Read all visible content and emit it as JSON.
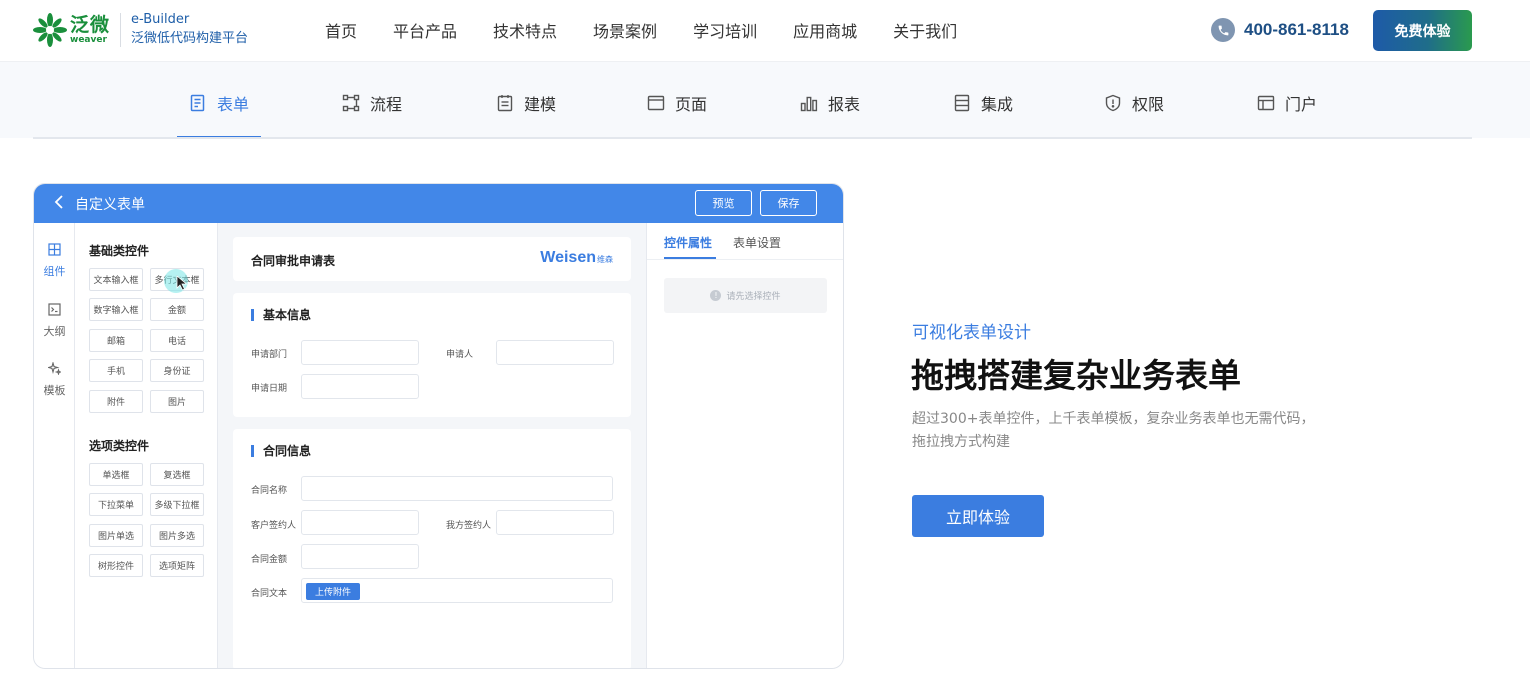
{
  "colors": {
    "brand_green": "#1a8f3c",
    "accent_blue": "#3b7de0",
    "header_blue": "#4287e8",
    "phone_navy": "#1e4f84"
  },
  "header": {
    "logo_cn": "泛微",
    "logo_en": "weaver",
    "product_name": "e-Builder",
    "product_sub": "泛微低代码构建平台",
    "nav": [
      "首页",
      "平台产品",
      "技术特点",
      "场景案例",
      "学习培训",
      "应用商城",
      "关于我们"
    ],
    "phone_icon": "phone-icon",
    "phone": "400-861-8118",
    "trial_label": "免费体验"
  },
  "tabs": [
    {
      "label": "表单",
      "icon": "form-icon",
      "active": true
    },
    {
      "label": "流程",
      "icon": "flow-icon"
    },
    {
      "label": "建模",
      "icon": "model-icon"
    },
    {
      "label": "页面",
      "icon": "page-icon"
    },
    {
      "label": "报表",
      "icon": "chart-icon"
    },
    {
      "label": "集成",
      "icon": "integration-icon"
    },
    {
      "label": "权限",
      "icon": "shield-icon"
    },
    {
      "label": "门户",
      "icon": "portal-icon"
    }
  ],
  "mockup": {
    "title": "自定义表单",
    "preview_label": "预览",
    "save_label": "保存",
    "rail": [
      {
        "label": "组件",
        "icon": "grid-icon",
        "active": true
      },
      {
        "label": "大纲",
        "icon": "outline-icon"
      },
      {
        "label": "模板",
        "icon": "sparkle-icon"
      }
    ],
    "basic_title": "基础类控件",
    "basic_controls": [
      "文本输入框",
      "多行文本框",
      "数字输入框",
      "金额",
      "邮箱",
      "电话",
      "手机",
      "身份证",
      "附件",
      "图片"
    ],
    "option_title": "选项类控件",
    "option_controls": [
      "单选框",
      "复选框",
      "下拉菜单",
      "多级下拉框",
      "图片单选",
      "图片多选",
      "树形控件",
      "选项矩阵"
    ],
    "form_title": "合同审批申请表",
    "brand": "Weisen",
    "brand_sub": "维森",
    "section1": "基本信息",
    "fields1": {
      "dept": "申请部门",
      "applicant": "申请人",
      "date": "申请日期"
    },
    "section2": "合同信息",
    "fields2": {
      "name": "合同名称",
      "customer": "客户签约人",
      "ours": "我方签约人",
      "amount": "合同金额",
      "text": "合同文本"
    },
    "upload_label": "上传附件",
    "props_tab1": "控件属性",
    "props_tab2": "表单设置",
    "props_empty": "请先选择控件"
  },
  "copy": {
    "eyebrow": "可视化表单设计",
    "headline": "拖拽搭建复杂业务表单",
    "desc_line1": "超过300+表单控件，上千表单模板，复杂业务表单也无需代码，",
    "desc_line2": "拖拉拽方式构建",
    "cta": "立即体验"
  }
}
